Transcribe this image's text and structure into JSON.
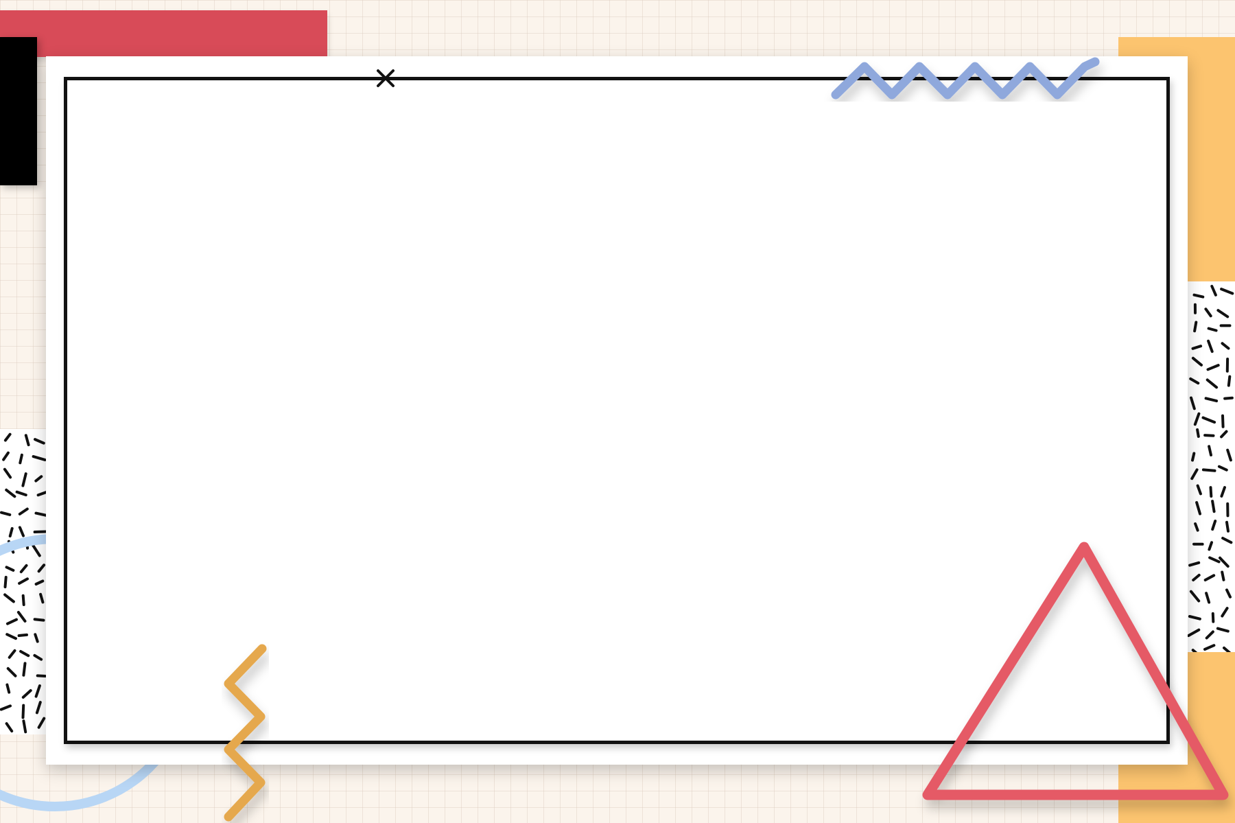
{
  "colors": {
    "background": "#fbf4ec",
    "grid_line": "#e3d6c8",
    "red_bar": "#d84b58",
    "black_block": "#000000",
    "orange_bar": "#fcc46f",
    "card": "#ffffff",
    "frame_border": "#111111",
    "zigzag_blue": "#8fa8dc",
    "zigzag_orange": "#e5a84e",
    "triangle_red": "#e55a66",
    "ring_blue": "#b8d6f5",
    "sprinkle_dots": "#111111"
  },
  "icons": {
    "cross": "close-icon",
    "blue_zigzag": "zigzag-icon",
    "orange_zigzag": "zigzag-icon",
    "triangle": "triangle-icon",
    "ring": "circle-ring-icon"
  }
}
